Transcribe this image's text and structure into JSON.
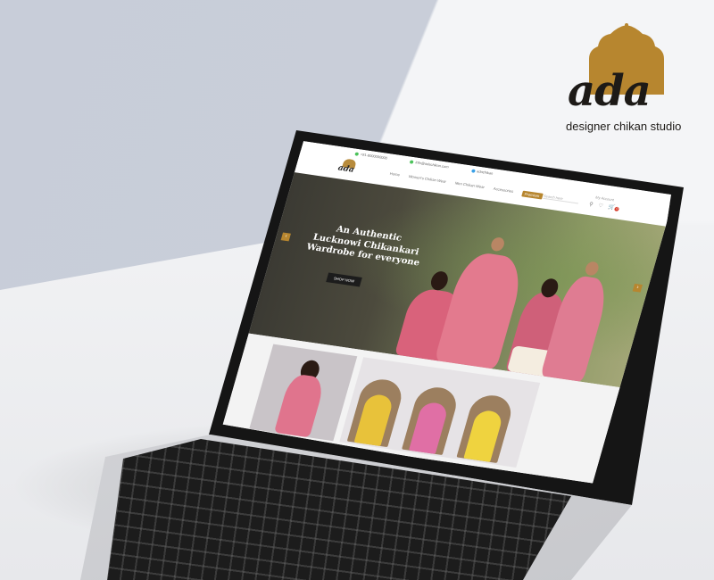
{
  "brand": {
    "wordmark": "ada",
    "tagline": "designer chikan studio",
    "accent_color": "#b7862f",
    "icon": "dome-arch-icon"
  },
  "site": {
    "topbar": {
      "phone": "+91-8000000000",
      "email": "info@adachikan.com",
      "social": "adachikan"
    },
    "logo": "ada",
    "nav": [
      "Home",
      "Women's Chikan Wear",
      "Men Chikan Wear",
      "Accessories",
      "Premium"
    ],
    "search_placeholder": "Search here",
    "account_label": "My Account",
    "cart_count": "0",
    "hero": {
      "headline_line1": "An Authentic",
      "headline_line2": "Lucknowi Chikankari",
      "headline_line3": "Wardrobe for everyone",
      "cta": "SHOP NOW"
    }
  },
  "colors": {
    "premium_badge": "#b7862f",
    "cta_bg": "#1c1c1c",
    "pink_garment": "#e07a90"
  }
}
